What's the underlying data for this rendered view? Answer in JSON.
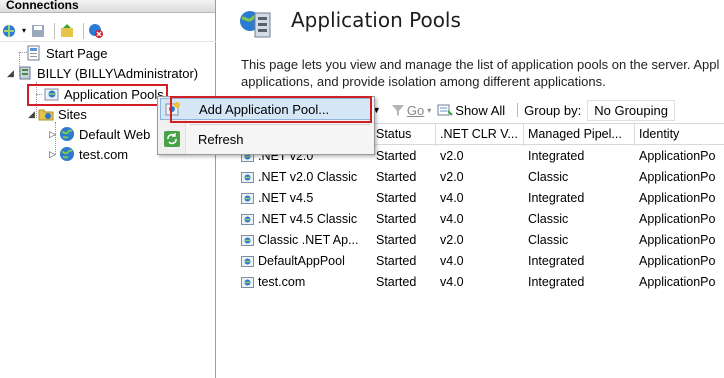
{
  "connections": {
    "header": "Connections",
    "tree": {
      "start_page": "Start Page",
      "server": "BILLY (BILLY\\Administrator)",
      "app_pools": "Application Pools",
      "sites": "Sites",
      "default_site": "Default Web",
      "test_site": "test.com"
    }
  },
  "page": {
    "title": "Application Pools",
    "description_line1": "This page lets you view and manage the list of application pools on the server. Appl",
    "description_line2": "applications, and provide isolation among different applications."
  },
  "filterbar": {
    "go_label": "Go",
    "show_all_label": "Show All",
    "group_by_label": "Group by:",
    "group_by_value": "No Grouping"
  },
  "context_menu": {
    "add_pool": "Add Application Pool...",
    "refresh": "Refresh"
  },
  "grid": {
    "columns": [
      "Status",
      ".NET CLR V...",
      "Managed Pipel...",
      "Identity"
    ],
    "rows": [
      {
        "name": ".NET v2.0",
        "status": "Started",
        "clr": "v2.0",
        "pipeline": "Integrated",
        "identity": "ApplicationPo"
      },
      {
        "name": ".NET v2.0 Classic",
        "status": "Started",
        "clr": "v2.0",
        "pipeline": "Classic",
        "identity": "ApplicationPo"
      },
      {
        "name": ".NET v4.5",
        "status": "Started",
        "clr": "v4.0",
        "pipeline": "Integrated",
        "identity": "ApplicationPo"
      },
      {
        "name": ".NET v4.5 Classic",
        "status": "Started",
        "clr": "v4.0",
        "pipeline": "Classic",
        "identity": "ApplicationPo"
      },
      {
        "name": "Classic .NET Ap...",
        "status": "Started",
        "clr": "v2.0",
        "pipeline": "Classic",
        "identity": "ApplicationPo"
      },
      {
        "name": "DefaultAppPool",
        "status": "Started",
        "clr": "v4.0",
        "pipeline": "Integrated",
        "identity": "ApplicationPo"
      },
      {
        "name": "test.com",
        "status": "Started",
        "clr": "v4.0",
        "pipeline": "Integrated",
        "identity": "ApplicationPo"
      }
    ]
  },
  "colors": {
    "highlight_red": "#d11f26",
    "menu_hover": "#d5e6f6"
  }
}
